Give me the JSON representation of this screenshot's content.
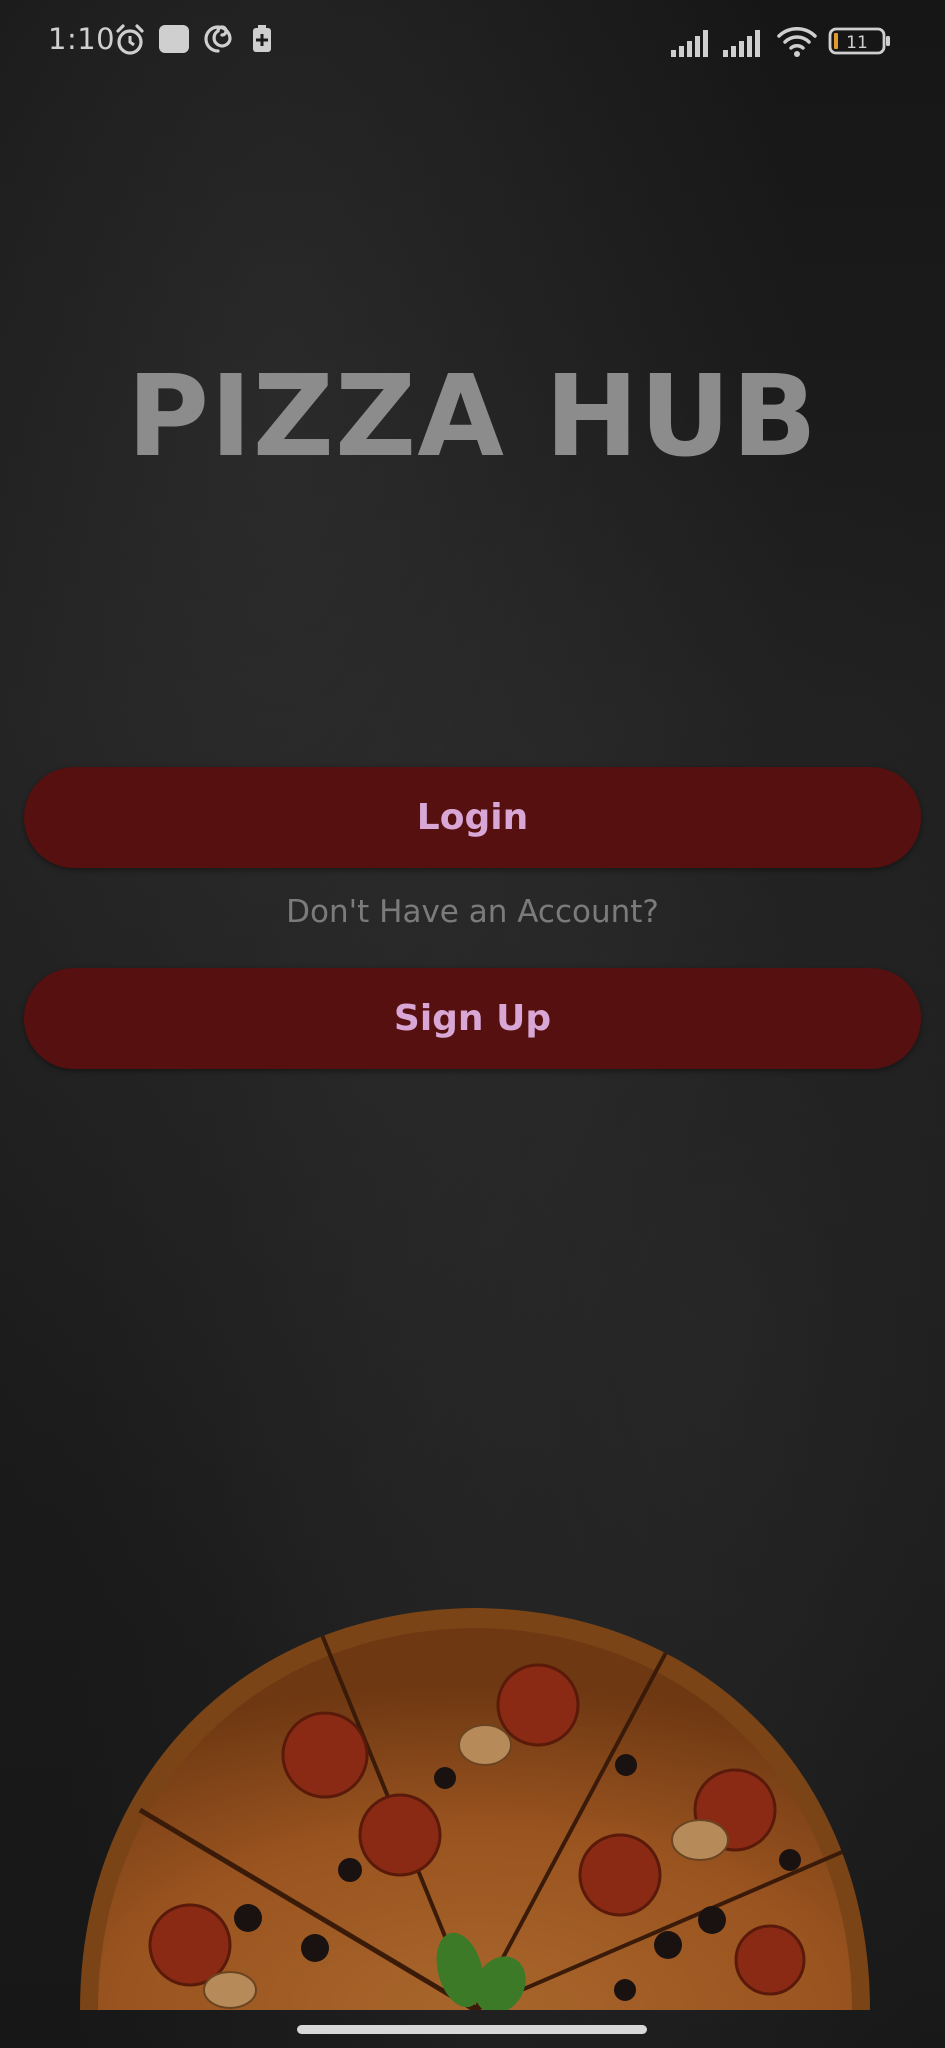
{
  "status_bar": {
    "time": "1:10",
    "battery_level": "11"
  },
  "title": "PIZZA HUB",
  "buttons": {
    "login_label": "Login",
    "signup_label": "Sign Up"
  },
  "account_prompt": "Don't Have an Account?",
  "colors": {
    "background": "#1b1b1b",
    "button_bg": "#561010",
    "button_text": "#d9a7d6",
    "title": "#8c8c8c",
    "prompt_text": "#7b7b7b"
  },
  "icons": {
    "status_left": [
      "alarm-icon",
      "square-notification-icon",
      "swirl-app-icon",
      "battery-saver-icon"
    ],
    "status_right": [
      "signal-icon",
      "signal-icon",
      "wifi-icon",
      "battery-icon"
    ]
  }
}
